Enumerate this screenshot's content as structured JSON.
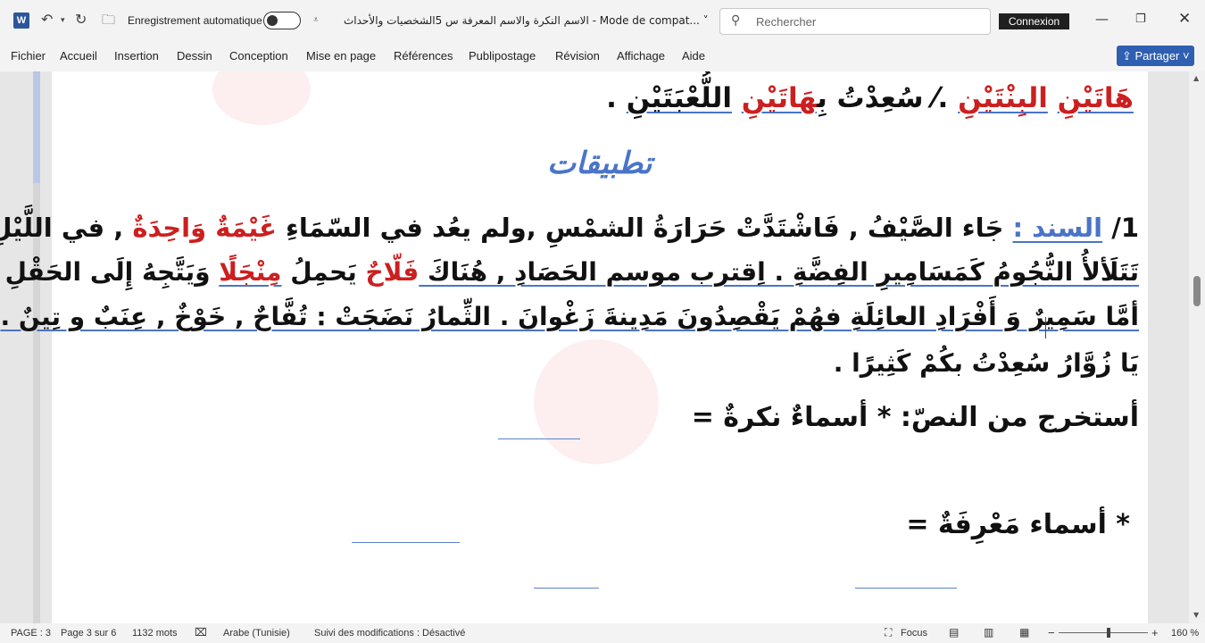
{
  "titlebar": {
    "app_letter": "W",
    "autosave_label": "Enregistrement automatique",
    "doc_title": "الاسم النكرة والاسم المعرفة س 5الشخصيات والأحداث  -  Mode de compat... ˅",
    "search_placeholder": "Rechercher",
    "signin_label": "Connexion",
    "icons": [
      "undo-icon",
      "redo-icon",
      "folder-icon",
      "customize-icon",
      "search-icon",
      "minimize-icon",
      "restore-icon",
      "close-icon"
    ]
  },
  "ribbon": {
    "tabs": [
      "Fichier",
      "Accueil",
      "Insertion",
      "Dessin",
      "Conception",
      "Mise en page",
      "Références",
      "Publipostage",
      "Révision",
      "Affichage",
      "Aide"
    ],
    "share_label": "Partager ˅"
  },
  "document": {
    "line0": {
      "w1": "هَاتَيْنِ",
      "w2": "البِنْتَيْنِ",
      "w3": ".⁄ سُعِدْتُ بِ",
      "w4": "هَاتَيْنِ",
      "w5": "اللُّعْبَتَيْنِ",
      "w6": " ."
    },
    "heading": "تطبيقات",
    "line1": {
      "num": "1/ ",
      "label": "السند :",
      "t1": " جَاء الصَّيْفُ , فَاشْتَدَّتْ حَرَارَةُ الشمْسِ ,ولم يعُد في السّمَاءِ ",
      "red": "غَيْمَةٌ وَاحِدَةٌ",
      "t2": " , في اللَّيْلِ"
    },
    "line2": {
      "t1": "تَتَلَألأُ النُّجُومُ كَمَسَامِيرِ الفِضَّةِ . اِقترب موسم الحَصَادِ , هُنَاكَ ",
      "red1": "فَلّاحٌ",
      "t2": " يَحمِلُ ",
      "red2": "مِنْجَلًا",
      "t3": " وَيَتَّجِهُ إِلَى الحَقْلِ"
    },
    "line3": "أمَّا سَمِيرٌ وَ أَفْرَادِ العائِلَةِ فهُمْ يَقْصِدُونَ مَدِينةَ زَغْوانَ . الثِّمارُ نَضَجَتْ : تُفَّاحٌ , خَوْخٌ , عِنَبٌ و تِينٌ .",
    "line4": "يَا زُوَّارُ سُعِدْتُ بكُمْ كَثِيرًا .",
    "q1": "أستخرج من النصّ: * أسماءٌ نكرةٌ =",
    "q2": "* أسماء مَعْرِفَةٌ ="
  },
  "status": {
    "page": "PAGE : 3",
    "page_of": "Page 3 sur 6",
    "words": "1132 mots",
    "language": "Arabe (Tunisie)",
    "track_changes": "Suivi des modifications : Désactivé",
    "focus": "Focus",
    "zoom": "160 %",
    "zoom_level": 1.6
  }
}
